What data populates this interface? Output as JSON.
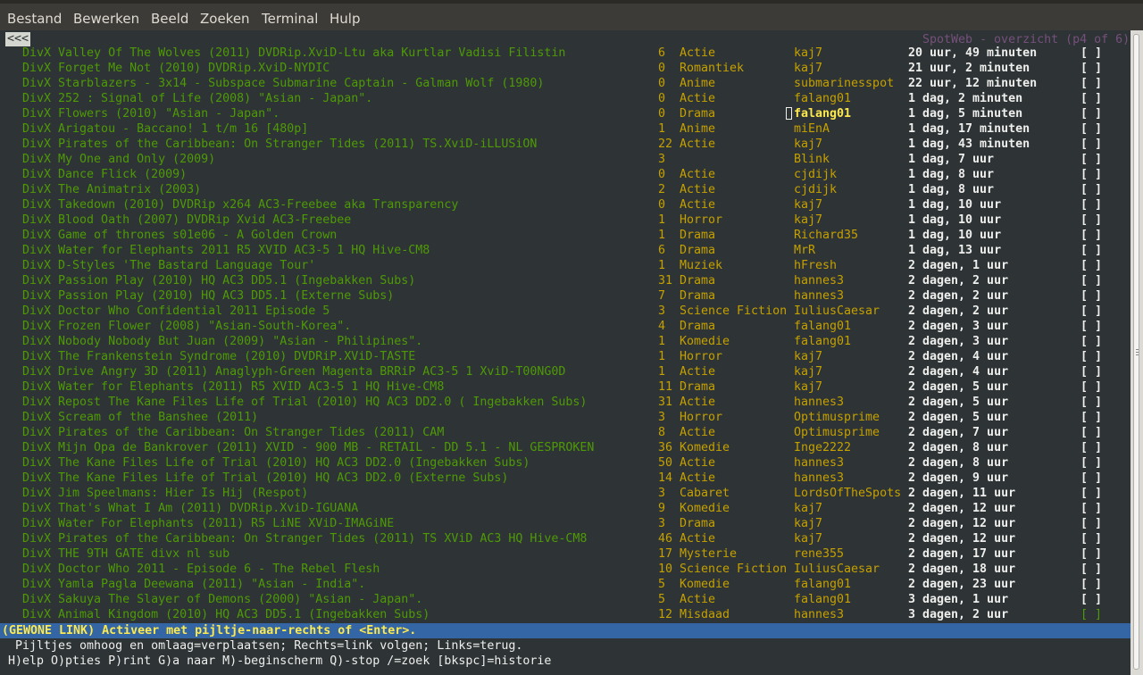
{
  "menubar": {
    "items": [
      "Bestand",
      "Bewerken",
      "Beeld",
      "Zoeken",
      "Terminal",
      "Hulp"
    ]
  },
  "terminal": {
    "back_link": "<<<",
    "page_info": "SpotWeb - overzicht (p4 of 6)",
    "rows": [
      {
        "title": "DivX Valley Of The Wolves (2011) DVDRip.XviD-Ltu aka Kurtlar Vadisi Filistin",
        "count": "6",
        "category": "Actie",
        "poster": "kaj7",
        "age": "20 uur, 49 minuten",
        "check": "[ ]"
      },
      {
        "title": "DivX Forget Me Not (2010) DVDRip.XviD-NYDIC",
        "count": "0",
        "category": "Romantiek",
        "poster": "kaj7",
        "age": "21 uur, 2 minuten",
        "check": "[ ]"
      },
      {
        "title": "DivX Starblazers - 3x14 - Subspace Submarine Captain - Galman Wolf (1980)",
        "count": "0",
        "category": "Anime",
        "poster": "submarinesspot",
        "age": "22 uur, 12 minuten",
        "check": "[ ]"
      },
      {
        "title": "DivX 252 : Signal of Life (2008) \"Asian - Japan\".",
        "count": "0",
        "category": "Actie",
        "poster": "falang01",
        "age": "1 dag, 2 minuten",
        "check": "[ ]"
      },
      {
        "title": "DivX Flowers (2010) \"Asian - Japan\".",
        "count": "0",
        "category": "Drama",
        "poster": "falang01",
        "age": "1 dag, 5 minuten",
        "check": "[ ]"
      },
      {
        "title": "DivX Arigatou - Baccano! 1 t/m 16 [480p]",
        "count": "1",
        "category": "Anime",
        "poster": "miEnA",
        "age": "1 dag, 17 minuten",
        "check": "[ ]"
      },
      {
        "title": "DivX Pirates of the Caribbean: On Stranger Tides (2011) TS.XviD-iLLUSiON",
        "count": "22",
        "category": "Actie",
        "poster": "kaj7",
        "age": "1 dag, 43 minuten",
        "check": "[ ]"
      },
      {
        "title": "DivX My One and Only (2009)",
        "count": "3",
        "category": "",
        "poster": "Blink",
        "age": "1 dag, 7 uur",
        "check": "[ ]"
      },
      {
        "title": "DivX Dance Flick (2009)",
        "count": "0",
        "category": "Actie",
        "poster": "cjdijk",
        "age": "1 dag, 8 uur",
        "check": "[ ]"
      },
      {
        "title": "DivX The Animatrix (2003)",
        "count": "2",
        "category": "Actie",
        "poster": "cjdijk",
        "age": "1 dag, 8 uur",
        "check": "[ ]"
      },
      {
        "title": "DivX Takedown (2010) DVDRip x264 AC3-Freebee aka Transparency",
        "count": "0",
        "category": "Actie",
        "poster": "kaj7",
        "age": "1 dag, 10 uur",
        "check": "[ ]"
      },
      {
        "title": "DivX Blood Oath (2007) DVDRip Xvid AC3-Freebee",
        "count": "1",
        "category": "Horror",
        "poster": "kaj7",
        "age": "1 dag, 10 uur",
        "check": "[ ]"
      },
      {
        "title": "DivX Game of thrones s01e06 - A Golden Crown",
        "count": "1",
        "category": "Drama",
        "poster": "Richard35",
        "age": "1 dag, 10 uur",
        "check": "[ ]"
      },
      {
        "title": "DivX Water for Elephants 2011 R5 XVID AC3-5 1 HQ Hive-CM8",
        "count": "6",
        "category": "Drama",
        "poster": "MrR",
        "age": "1 dag, 13 uur",
        "check": "[ ]"
      },
      {
        "title": "DivX D-Styles 'The Bastard Language Tour'",
        "count": "1",
        "category": "Muziek",
        "poster": "hFresh",
        "age": "2 dagen, 1 uur",
        "check": "[ ]"
      },
      {
        "title": "DivX Passion Play (2010) HQ AC3 DD5.1 (Ingebakken Subs)",
        "count": "31",
        "category": "Drama",
        "poster": "hannes3",
        "age": "2 dagen, 2 uur",
        "check": "[ ]"
      },
      {
        "title": "DivX Passion Play (2010) HQ AC3 DD5.1 (Externe Subs)",
        "count": "7",
        "category": "Drama",
        "poster": "hannes3",
        "age": "2 dagen, 2 uur",
        "check": "[ ]"
      },
      {
        "title": "DivX Doctor Who Confidential 2011 Episode 5",
        "count": "3",
        "category": "Science Fiction",
        "poster": "IuliusCaesar",
        "age": "2 dagen, 2 uur",
        "check": "[ ]"
      },
      {
        "title": "DivX Frozen Flower (2008) \"Asian-South-Korea\".",
        "count": "4",
        "category": "Drama",
        "poster": "falang01",
        "age": "2 dagen, 3 uur",
        "check": "[ ]"
      },
      {
        "title": "DivX Nobody Nobody But Juan (2009) \"Asian - Philipines\".",
        "count": "1",
        "category": "Komedie",
        "poster": "falang01",
        "age": "2 dagen, 3 uur",
        "check": "[ ]"
      },
      {
        "title": "DivX The Frankenstein Syndrome (2010) DVDRiP.XViD-TASTE",
        "count": "1",
        "category": "Horror",
        "poster": "kaj7",
        "age": "2 dagen, 4 uur",
        "check": "[ ]"
      },
      {
        "title": "DivX Drive Angry 3D (2011) Anaglyph-Green Magenta BRRiP AC3-5 1 XviD-T00NG0D",
        "count": "1",
        "category": "Actie",
        "poster": "kaj7",
        "age": "2 dagen, 4 uur",
        "check": "[ ]"
      },
      {
        "title": "DivX Water for Elephants (2011) R5 XVID AC3-5 1 HQ Hive-CM8",
        "count": "11",
        "category": "Drama",
        "poster": "kaj7",
        "age": "2 dagen, 5 uur",
        "check": "[ ]"
      },
      {
        "title": "DivX Repost The Kane Files Life of Trial (2010) HQ AC3 DD2.0 ( Ingebakken Subs)",
        "count": "31",
        "category": "Actie",
        "poster": "hannes3",
        "age": "2 dagen, 5 uur",
        "check": "[ ]"
      },
      {
        "title": "DivX Scream of the Banshee (2011)",
        "count": "3",
        "category": "Horror",
        "poster": "Optimusprime",
        "age": "2 dagen, 5 uur",
        "check": "[ ]"
      },
      {
        "title": "DivX Pirates of the Caribbean: On Stranger Tides (2011) CAM",
        "count": "8",
        "category": "Actie",
        "poster": "Optimusprime",
        "age": "2 dagen, 7 uur",
        "check": "[ ]"
      },
      {
        "title": "DivX Mijn Opa de Bankrover (2011) XVID - 900 MB - RETAIL - DD 5.1 - NL GESPROKEN",
        "count": "36",
        "category": "Komedie",
        "poster": "Inge2222",
        "age": "2 dagen, 8 uur",
        "check": "[ ]"
      },
      {
        "title": "DivX The Kane Files Life of Trial (2010) HQ AC3 DD2.0 (Ingebakken Subs)",
        "count": "50",
        "category": "Actie",
        "poster": "hannes3",
        "age": "2 dagen, 8 uur",
        "check": "[ ]"
      },
      {
        "title": "DivX The Kane Files Life of Trial (2010) HQ AC3 DD2.0 (Externe Subs)",
        "count": "14",
        "category": "Actie",
        "poster": "hannes3",
        "age": "2 dagen, 9 uur",
        "check": "[ ]"
      },
      {
        "title": "DivX Jim Speelmans: Hier Is Hij (Respot)",
        "count": "3",
        "category": "Cabaret",
        "poster": "LordsOfTheSpots",
        "age": "2 dagen, 11 uur",
        "check": "[ ]"
      },
      {
        "title": "DivX That's What I Am (2011) DVDRip.XviD-IGUANA",
        "count": "9",
        "category": "Komedie",
        "poster": "kaj7",
        "age": "2 dagen, 12 uur",
        "check": "[ ]"
      },
      {
        "title": "DivX Water For Elephants (2011) R5 LiNE XViD-IMAGiNE",
        "count": "3",
        "category": "Drama",
        "poster": "kaj7",
        "age": "2 dagen, 12 uur",
        "check": "[ ]"
      },
      {
        "title": "DivX Pirates of the Caribbean: On Stranger Tides (2011) TS XViD AC3 HQ Hive-CM8",
        "count": "46",
        "category": "Actie",
        "poster": "kaj7",
        "age": "2 dagen, 12 uur",
        "check": "[ ]"
      },
      {
        "title": "DivX THE 9TH GATE divx nl sub",
        "count": "17",
        "category": "Mysterie",
        "poster": "rene355",
        "age": "2 dagen, 17 uur",
        "check": "[ ]"
      },
      {
        "title": "DivX Doctor Who 2011 - Episode 6 - The Rebel Flesh",
        "count": "10",
        "category": "Science Fiction",
        "poster": "IuliusCaesar",
        "age": "2 dagen, 18 uur",
        "check": "[ ]"
      },
      {
        "title": "DivX Yamla Pagla Deewana (2011) \"Asian - India\".",
        "count": "5",
        "category": "Komedie",
        "poster": "falang01",
        "age": "2 dagen, 23 uur",
        "check": "[ ]"
      },
      {
        "title": "DivX Sakuya The Slayer of Demons (2000) \"Asian - Japan\".",
        "count": "5",
        "category": "Actie",
        "poster": "falang01",
        "age": "3 dagen, 1 uur",
        "check": "[ ]"
      },
      {
        "title": "DivX Animal Kingdom (2010) HQ AC3 DD5.1 (Ingebakken Subs)",
        "count": "12",
        "category": "Misdaad",
        "poster": "hannes3",
        "age": "3 dagen, 2 uur",
        "check": "[ ]"
      }
    ],
    "status_line": "(GEWONE LINK) Activeer met pijltje-naar-rechts of <Enter>.",
    "help_line_1": "Pijltjes omhoog en omlaag=verplaatsen; Rechts=link volgen; Links=terug.",
    "help_line_2": "H)elp O)pties P)rint G)a naar M)-beginscherm Q)-stop /=zoek [bkspc]=historie"
  }
}
